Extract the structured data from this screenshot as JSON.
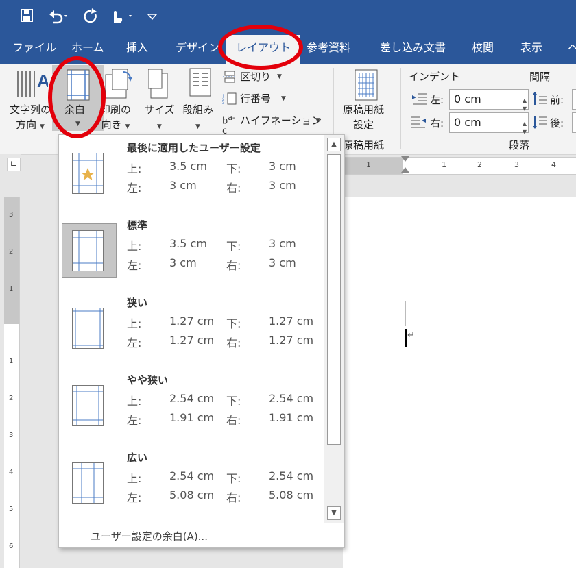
{
  "quick_access": {
    "icons": [
      "save-icon",
      "undo-icon",
      "redo-icon",
      "touch-mode-icon",
      "customize-icon"
    ]
  },
  "tabs": [
    "ファイル",
    "ホーム",
    "挿入",
    "デザイン",
    "レイアウト",
    "参考資料",
    "差し込み文書",
    "校閲",
    "表示",
    "ヘ"
  ],
  "ribbon": {
    "text_direction": {
      "line1": "文字列の",
      "line2": "方向"
    },
    "margins": "余白",
    "orientation": {
      "line1": "印刷の",
      "line2": "向き"
    },
    "size": "サイズ",
    "columns": "段組み",
    "breaks": "区切り",
    "line_numbers": "行番号",
    "hyphenation": "ハイフネーション",
    "genko": {
      "line1": "原稿用紙",
      "line2": "設定"
    },
    "genko_group": "原稿用紙",
    "indent_label": "インデント",
    "spacing_label": "間隔",
    "indent_left_label": "左:",
    "indent_left_value": "0 cm",
    "indent_right_label": "右:",
    "indent_right_value": "0 cm",
    "before_label": "前:",
    "after_label": "後:",
    "paragraph_group": "段落"
  },
  "margins_menu": {
    "options": [
      {
        "title": "最後に適用したユーザー設定",
        "top": "3.5 cm",
        "bottom": "3 cm",
        "left": "3 cm",
        "right": "3 cm"
      },
      {
        "title": "標準",
        "top": "3.5 cm",
        "bottom": "3 cm",
        "left": "3 cm",
        "right": "3 cm"
      },
      {
        "title": "狭い",
        "top": "1.27 cm",
        "bottom": "1.27 cm",
        "left": "1.27 cm",
        "right": "1.27 cm"
      },
      {
        "title": "やや狭い",
        "top": "2.54 cm",
        "bottom": "2.54 cm",
        "left": "1.91 cm",
        "right": "1.91 cm"
      },
      {
        "title": "広い",
        "top": "2.54 cm",
        "bottom": "2.54 cm",
        "left": "5.08 cm",
        "right": "5.08 cm"
      }
    ],
    "label_top": "上:",
    "label_bottom": "下:",
    "label_left": "左:",
    "label_right": "右:",
    "custom": "ユーザー設定の余白(A)...",
    "selected": "標準"
  },
  "ruler": {
    "h_ticks": [
      "1",
      "1",
      "2",
      "3",
      "4"
    ],
    "v_ticks": [
      "3",
      "2",
      "1",
      "1",
      "2",
      "3",
      "4",
      "5",
      "6"
    ]
  },
  "accent_colors": {
    "title_bar": "#2b579a",
    "highlight": "#e3000b"
  }
}
